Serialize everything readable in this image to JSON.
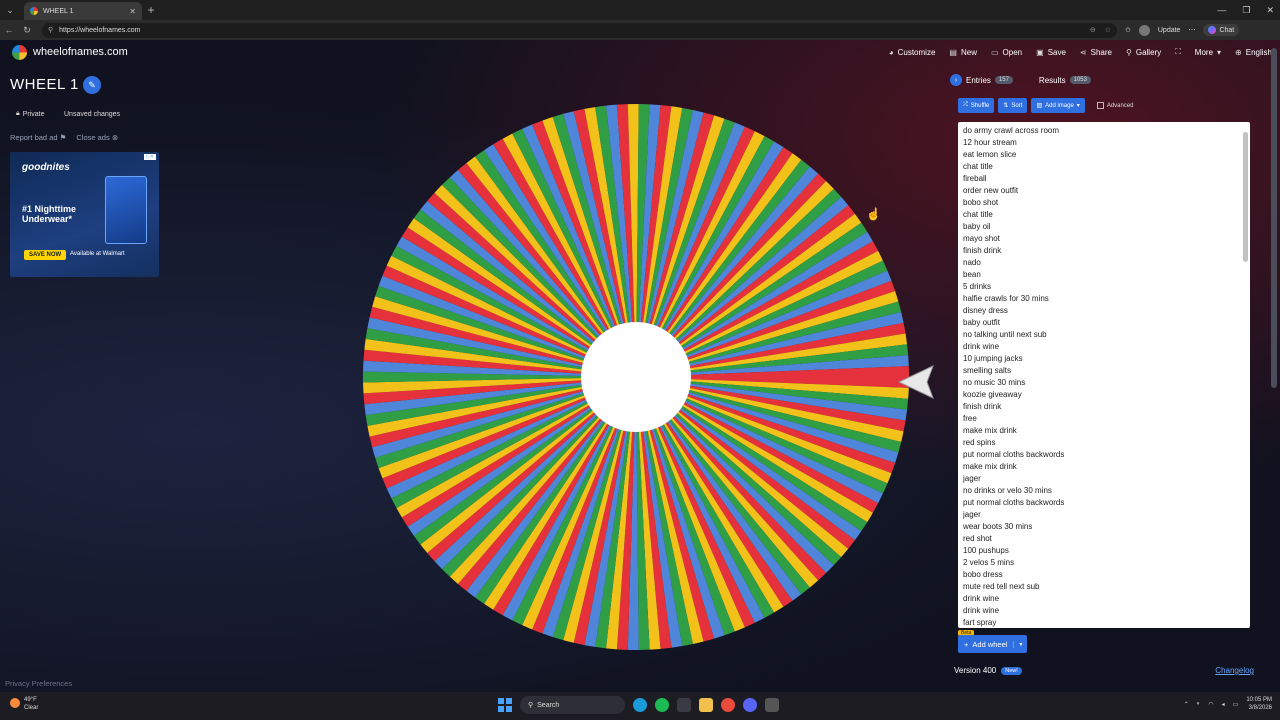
{
  "browser": {
    "tab_title": "WHEEL 1",
    "url": "https://wheelofnames.com",
    "update_label": "Update",
    "chat_label": "Chat"
  },
  "header": {
    "site_name": "wheelofnames.com",
    "menu": [
      "Customize",
      "New",
      "Open",
      "Save",
      "Share",
      "Gallery",
      "",
      "More",
      "English"
    ]
  },
  "wheel": {
    "title": "WHEEL 1",
    "private_label": "Private",
    "unsaved_label": "Unsaved changes",
    "report_label": "Report bad ad",
    "close_ads_label": "Close ads",
    "segment_colors": [
      "#e5313c",
      "#f2c21b",
      "#2f9e44",
      "#4f86d9"
    ],
    "segment_count": 157
  },
  "ad": {
    "brand": "goodnites",
    "headline": "#1 Nighttime Underwear*",
    "cta": "SAVE NOW",
    "retailer": "Available at Walmart"
  },
  "privacy_label": "Privacy Preferences",
  "panel": {
    "entries_tab": "Entries",
    "entries_count": "157",
    "results_tab": "Results",
    "results_count": "1053",
    "shuffle_label": "Shuffle",
    "sort_label": "Sort",
    "add_image_label": "Add image",
    "advanced_label": "Advanced",
    "entries": [
      "do army crawl across room",
      "12 hour stream",
      "eat lemon slice",
      "chat title",
      "fireball",
      "order new outfit",
      "bobo shot",
      "chat title",
      "baby oil",
      "mayo shot",
      "finish drink",
      "nado",
      "bean",
      "5 drinks",
      "halfie crawls for 30 mins",
      "disney dress",
      "baby outfit",
      "no talking until next sub",
      "drink wine",
      "10 jumping jacks",
      "smelling salts",
      "no music 30 mins",
      "koozie giveaway",
      "finish drink",
      "free",
      "make mix drink",
      "red spins",
      "put normal cloths backwords",
      "make mix drink",
      "jager",
      "no drinks or velo 30 mins",
      "put normal cloths backwords",
      "jager",
      "wear boots 30 mins",
      "red shot",
      "100 pushups",
      "2 velos 5 mins",
      "bobo dress",
      "mute red tell next sub",
      "drink wine",
      "drink wine",
      "fart spray"
    ],
    "beta_label": "Beta",
    "add_wheel_label": "Add wheel",
    "version_label": "Version 400",
    "new_badge": "New!",
    "changelog_label": "Changelog"
  },
  "taskbar": {
    "weather_temp": "49°F",
    "weather_desc": "Clear",
    "search_label": "Search",
    "time": "10:05 PM",
    "date": "3/8/2026"
  }
}
